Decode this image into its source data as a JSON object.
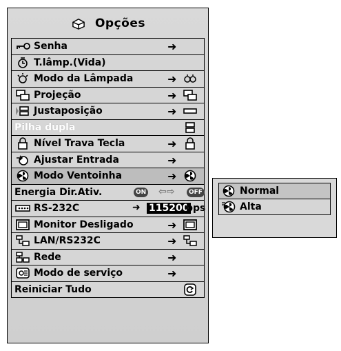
{
  "menu": {
    "title": "Opções",
    "items": [
      {
        "label": "Senha",
        "icon": "key-icon",
        "arrow": "➜",
        "value_icon": ""
      },
      {
        "label": "T.lâmp.(Vida)",
        "icon": "lamp-timer-icon",
        "arrow": "",
        "value_icon": ""
      },
      {
        "label": "Modo da Lâmpada",
        "icon": "lamp-icon",
        "arrow": "➜",
        "value_icon": "lamp-mode-icon"
      },
      {
        "label": "Projeção",
        "icon": "projection-icon",
        "arrow": "➜",
        "value_icon": "projection-icon"
      },
      {
        "label": "Justaposição",
        "icon": "stack-icon",
        "arrow": "➜",
        "value_icon": "stack-value-icon"
      },
      {
        "label": "Pilha dupla",
        "icon": "",
        "arrow": "",
        "value_icon": "double-stack-icon",
        "disabled": true
      },
      {
        "label": "Nível Trava Tecla",
        "icon": "lock-icon",
        "arrow": "➜",
        "value_icon": "lock-icon"
      },
      {
        "label": "Ajustar Entrada",
        "icon": "input-icon",
        "arrow": "➜",
        "value_icon": ""
      },
      {
        "label": "Modo Ventoinha",
        "icon": "fan-icon",
        "arrow": "➜",
        "value_icon": "fan-icon",
        "selected": true
      },
      {
        "label": "Energia Dir.Ativ.",
        "on": "ON",
        "off": "OFF",
        "swap": "⇦⇨"
      },
      {
        "label": "RS-232C",
        "icon": "rs232-icon",
        "arrow": "➜",
        "baud": "115200",
        "unit": "bps"
      },
      {
        "label": "Monitor Desligado",
        "icon": "monitor-icon",
        "arrow": "➜",
        "value_icon": "monitor-icon"
      },
      {
        "label": "LAN/RS232C",
        "icon": "lan-icon",
        "arrow": "➜",
        "value_icon": "lan-icon"
      },
      {
        "label": "Rede",
        "icon": "network-icon",
        "arrow": "➜",
        "value_icon": ""
      },
      {
        "label": "Modo de serviço",
        "icon": "service-icon",
        "arrow": "➜",
        "value_icon": ""
      },
      {
        "label": "Reiniciar Tudo",
        "icon": "",
        "arrow": "",
        "value_icon": "reset-icon"
      }
    ]
  },
  "submenu": {
    "items": [
      {
        "label": "Normal",
        "icon": "fan-icon",
        "selected": true
      },
      {
        "label": "Alta",
        "icon": "fan-high-icon",
        "selected": false
      }
    ]
  }
}
